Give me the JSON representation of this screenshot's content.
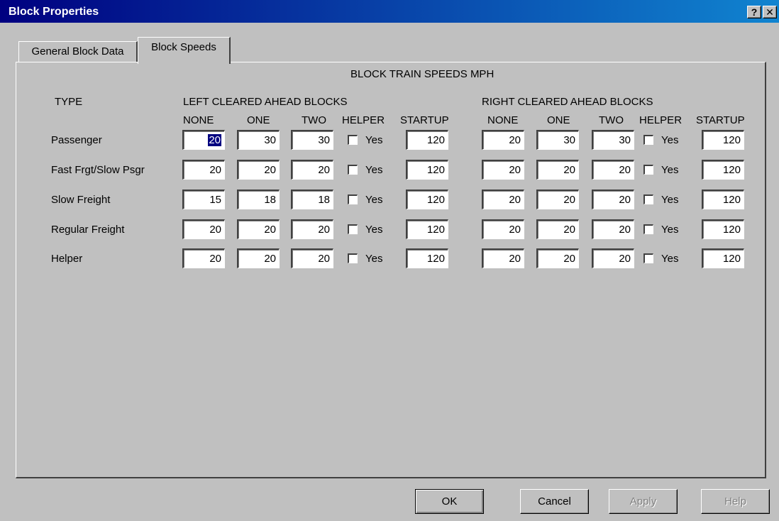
{
  "window": {
    "title": "Block Properties",
    "help_glyph": "?",
    "close_glyph": "✕"
  },
  "tabs": [
    {
      "label": "General Block Data"
    },
    {
      "label": "Block Speeds"
    }
  ],
  "panel": {
    "heading": "BLOCK TRAIN SPEEDS MPH",
    "type_header": "TYPE",
    "left_group": "LEFT CLEARED AHEAD BLOCKS",
    "right_group": "RIGHT CLEARED AHEAD BLOCKS",
    "columns": [
      "NONE",
      "ONE",
      "TWO",
      "HELPER",
      "STARTUP"
    ],
    "checkbox_label": "Yes",
    "rows": [
      {
        "type": "Passenger",
        "left": {
          "none": "20",
          "one": "30",
          "two": "30",
          "helper": false,
          "startup": "120"
        },
        "right": {
          "none": "20",
          "one": "30",
          "two": "30",
          "helper": false,
          "startup": "120"
        }
      },
      {
        "type": "Fast Frgt/Slow Psgr",
        "left": {
          "none": "20",
          "one": "20",
          "two": "20",
          "helper": false,
          "startup": "120"
        },
        "right": {
          "none": "20",
          "one": "20",
          "two": "20",
          "helper": false,
          "startup": "120"
        }
      },
      {
        "type": "Slow Freight",
        "left": {
          "none": "15",
          "one": "18",
          "two": "18",
          "helper": false,
          "startup": "120"
        },
        "right": {
          "none": "20",
          "one": "20",
          "two": "20",
          "helper": false,
          "startup": "120"
        }
      },
      {
        "type": "Regular Freight",
        "left": {
          "none": "20",
          "one": "20",
          "two": "20",
          "helper": false,
          "startup": "120"
        },
        "right": {
          "none": "20",
          "one": "20",
          "two": "20",
          "helper": false,
          "startup": "120"
        }
      },
      {
        "type": "Helper",
        "left": {
          "none": "20",
          "one": "20",
          "two": "20",
          "helper": false,
          "startup": "120"
        },
        "right": {
          "none": "20",
          "one": "20",
          "two": "20",
          "helper": false,
          "startup": "120"
        }
      }
    ]
  },
  "buttons": {
    "ok": "OK",
    "cancel": "Cancel",
    "apply": "Apply",
    "help": "Help"
  },
  "colors": {
    "title_bar_start": "#000080",
    "title_bar_end": "#1084d0",
    "face": "#c0c0c0",
    "selection": "#000080"
  }
}
